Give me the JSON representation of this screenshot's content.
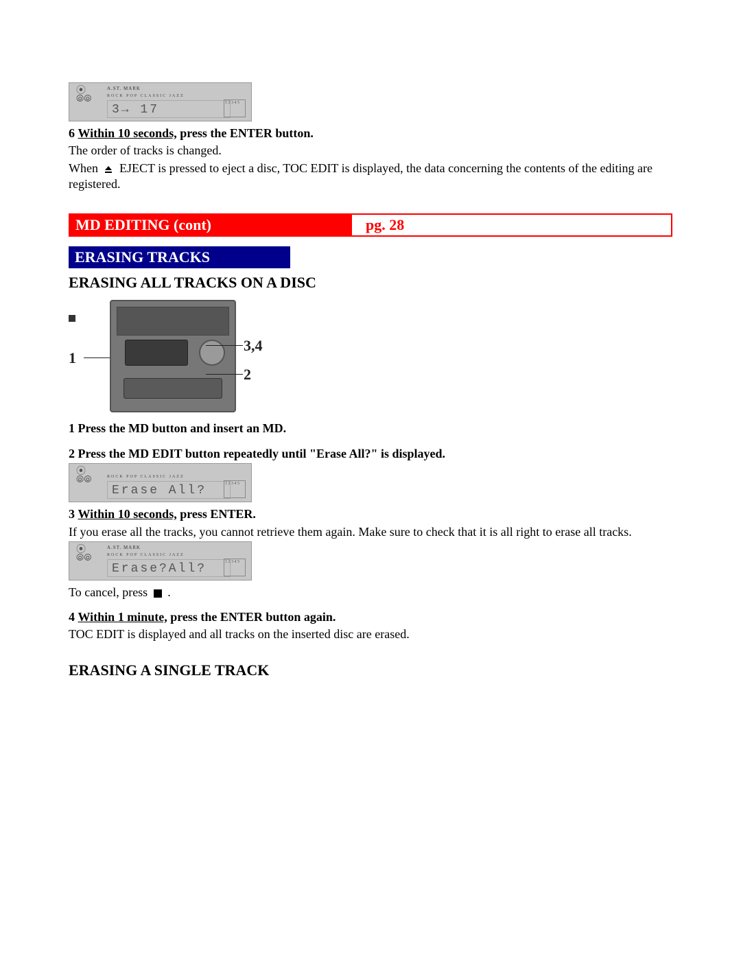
{
  "display1": {
    "top": "A.ST. MARK",
    "mid": "ROCK  POP  CLASSIC  JAZZ",
    "lcd": "3→   17",
    "grid": "1 2 3 4 5"
  },
  "step6": {
    "num": "6",
    "underline": "Within 10 seconds,",
    "rest": " press the ENTER button.",
    "line1": "The order of tracks is changed.",
    "line2a": "When ",
    "line2b": " EJECT is pressed to eject a disc, TOC EDIT is displayed, the data concerning the contents of the editing are registered."
  },
  "header": {
    "title": "MD EDITING (cont)",
    "page": "pg. 28"
  },
  "subsection": "ERASING TRACKS",
  "h3_1": "ERASING ALL TRACKS ON A DISC",
  "callouts": {
    "c1": "1",
    "c34": "3,4",
    "c2": "2"
  },
  "step1": {
    "num": "1",
    "text": " Press the MD button and insert an MD."
  },
  "step2": {
    "num": "2",
    "text": " Press the MD EDIT button repeatedly until \"Erase All?\" is displayed."
  },
  "display2": {
    "top": "",
    "mid": "ROCK  POP  CLASSIC  JAZZ",
    "lcd": "Erase All?",
    "grid": "1 2 3 4 5"
  },
  "step3": {
    "num": "3",
    "underline": "Within 10 seconds,",
    "rest": " press ENTER.",
    "line1": "If you erase all the tracks, you cannot retrieve them again.  Make sure to check that it is all right to erase all tracks."
  },
  "display3": {
    "top": "A.ST. MARK",
    "mid": "ROCK  POP  CLASSIC  JAZZ",
    "lcd": "Erase?All?",
    "grid": "1 2 3 4 5"
  },
  "cancel": {
    "pre": "To cancel, press ",
    "post": " ."
  },
  "step4": {
    "num": "4",
    "underline": "Within 1 minute,",
    "rest": " press the ENTER button again.",
    "line1": "TOC EDIT is displayed and all tracks on the inserted disc are erased."
  },
  "h3_2": "ERASING A SINGLE TRACK"
}
